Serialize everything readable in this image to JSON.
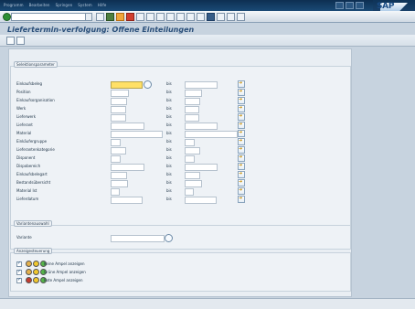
{
  "menubar": {
    "items": [
      "Programm",
      "Bearbeiten",
      "Springen",
      "System",
      "Hilfe"
    ]
  },
  "app": {
    "title": "Liefertermin-verfolgung: Offene Einteilungen",
    "logo": "SAP"
  },
  "selection": {
    "title": "Selektionsparameter",
    "rows": [
      {
        "label": "Einkaufsbeleg",
        "to": "bis"
      },
      {
        "label": "Position",
        "to": "bis"
      },
      {
        "label": "Einkaufsorganisation",
        "to": "bis"
      },
      {
        "label": "Werk",
        "to": "bis"
      },
      {
        "label": "Lieferwerk",
        "to": "bis"
      },
      {
        "label": "Lieferant",
        "to": "bis"
      },
      {
        "label": "Material",
        "to": "bis"
      },
      {
        "label": "Einkäufergruppe",
        "to": "bis"
      },
      {
        "label": "Lieferantenkategorie",
        "to": "bis"
      },
      {
        "label": "Disponent",
        "to": "bis"
      },
      {
        "label": "Dispobereich",
        "to": "bis"
      },
      {
        "label": "Einkaufsbelegart",
        "to": "bis"
      },
      {
        "label": "Bestandsübersicht",
        "to": "bis"
      },
      {
        "label": "Material Ist",
        "to": "bis"
      },
      {
        "label": "Lieferdatum",
        "to": "bis"
      }
    ]
  },
  "variant": {
    "title": "Variantenauswahl",
    "label": "Variante"
  },
  "display": {
    "title": "Anzeigesteuerung",
    "options": [
      {
        "label": "Keine Ampel anzeigen"
      },
      {
        "label": "Grüne Ampel anzeigen"
      },
      {
        "label": "Rote Ampel anzeigen"
      }
    ]
  }
}
